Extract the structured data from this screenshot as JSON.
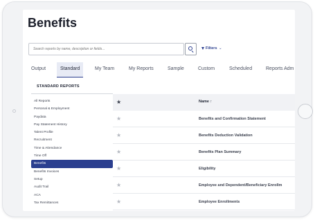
{
  "page": {
    "title": "Benefits"
  },
  "search": {
    "placeholder": "Search reports by name, description or fields..."
  },
  "filters": {
    "label": "Filters",
    "chevron": "⌄"
  },
  "tabs": [
    {
      "label": "Output"
    },
    {
      "label": "Standard",
      "active": true
    },
    {
      "label": "My Team"
    },
    {
      "label": "My Reports"
    },
    {
      "label": "Sample"
    },
    {
      "label": "Custom"
    },
    {
      "label": "Scheduled"
    },
    {
      "label": "Reports Adm"
    }
  ],
  "sidebar": {
    "header": "STANDARD REPORTS",
    "items": [
      {
        "label": "All Reports"
      },
      {
        "label": "Personal & Employment"
      },
      {
        "label": "Paydata"
      },
      {
        "label": "Pay Statement History"
      },
      {
        "label": "Talent Profile"
      },
      {
        "label": "Recruitment"
      },
      {
        "label": "Time & Attendance"
      },
      {
        "label": "Time Off"
      },
      {
        "label": "Benefits",
        "active": true
      },
      {
        "label": "Benefits Invoices"
      },
      {
        "label": "Setup"
      },
      {
        "label": "Audit Trail"
      },
      {
        "label": "ACA"
      },
      {
        "label": "Tax Remittances"
      }
    ]
  },
  "table": {
    "header": {
      "star": "★",
      "name": "Name ↑"
    },
    "rows": [
      {
        "star": "★",
        "name": "Benefits and Confirmation Statement"
      },
      {
        "star": "★",
        "name": "Benefits Deduction Validation"
      },
      {
        "star": "★",
        "name": "Benefits Plan Summary"
      },
      {
        "star": "★",
        "name": "Eligibility"
      },
      {
        "star": "★",
        "name": "Employee and Dependent/Beneficiary Enrollm"
      },
      {
        "star": "★",
        "name": "Employee Enrollments"
      }
    ]
  },
  "colors": {
    "accent": "#2b3f8f",
    "active_tab_bg": "#e8ebf5",
    "header_bg": "#f1f2f5"
  }
}
